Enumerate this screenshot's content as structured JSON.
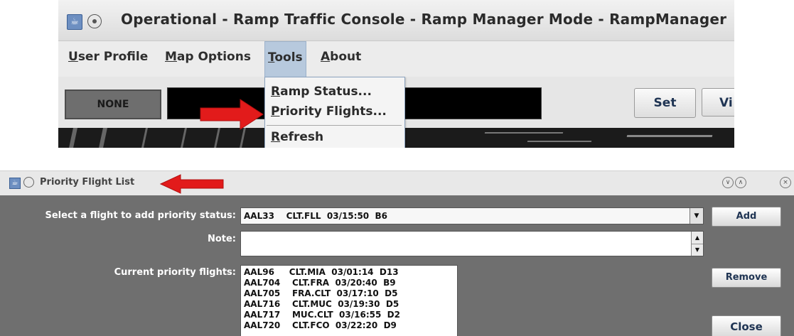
{
  "console": {
    "title": "Operational - Ramp Traffic Console - Ramp Manager Mode - RampManager",
    "menu": [
      {
        "key": "U",
        "rest": "ser Profile"
      },
      {
        "key": "M",
        "rest": "ap Options"
      },
      {
        "key": "T",
        "rest": "ools"
      },
      {
        "key": "A",
        "rest": "bout"
      }
    ],
    "toolbar": {
      "mode_value": "NONE",
      "set_label": "Set",
      "vi_label": "Vi"
    },
    "tools_menu": [
      {
        "key": "R",
        "rest": "amp Status..."
      },
      {
        "key": "P",
        "rest": "riority Flights..."
      },
      {
        "key": "R",
        "rest": "efresh"
      }
    ]
  },
  "priority_window": {
    "title": "Priority Flight List",
    "select_label": "Select a flight to add priority status:",
    "selected_flight": "AAL33    CLT.FLL  03/15:50  B6",
    "note_label": "Note:",
    "note_value": "",
    "current_label": "Current priority flights:",
    "current_flights": [
      "AAL96     CLT.MIA  03/01:14  D13",
      "AAL704    CLT.FRA  03/20:40  B9",
      "AAL705    FRA.CLT  03/17:10  D5",
      "AAL716    CLT.MUC  03/19:30  D5",
      "AAL717    MUC.CLT  03/16:55  D2",
      "AAL720    CLT.FCO  03/22:20  D9"
    ],
    "add_label": "Add",
    "remove_label": "Remove",
    "close_label": "Close"
  },
  "colors": {
    "annotation_arrow": "#e21b1b",
    "dialog_body": "#6f6f6f",
    "menu_highlight": "#b7c9dd"
  }
}
